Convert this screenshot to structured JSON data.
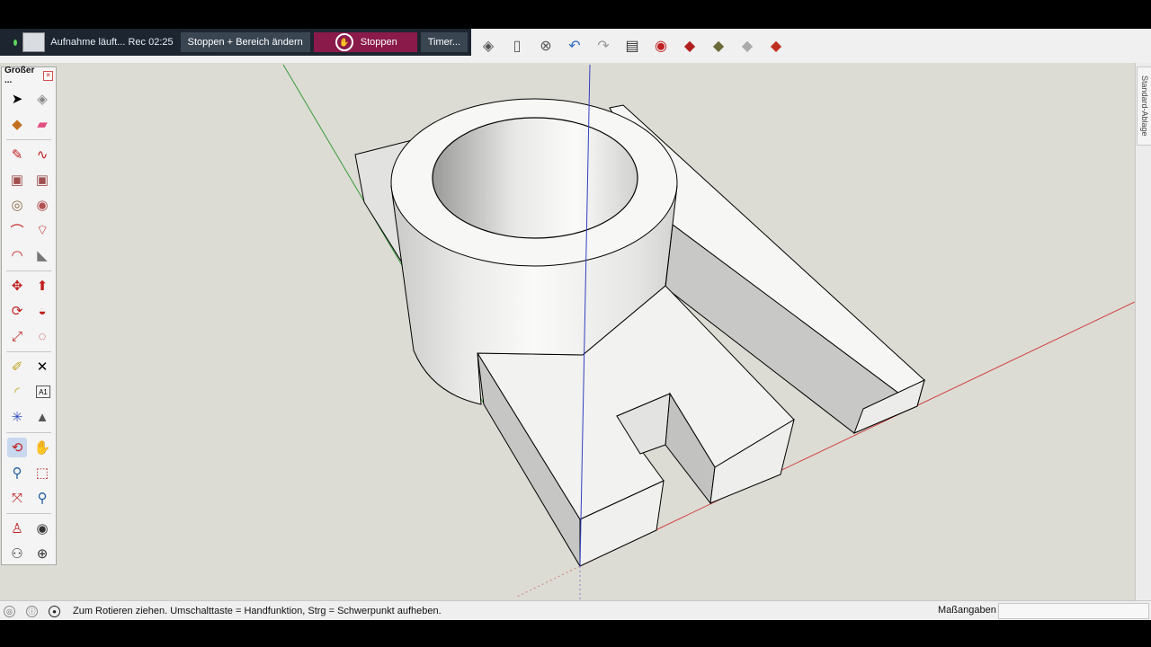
{
  "recorder": {
    "status": "Aufnahme läuft... Rec 02:25",
    "stop_change_label": "Stoppen + Bereich ändern",
    "stop_label": "Stoppen",
    "timer_label": "Timer..."
  },
  "toolbar_icons": [
    "previous-view-icon",
    "next-view-icon",
    "cancel-icon",
    "undo-icon",
    "redo-icon",
    "print-icon",
    "model-info-icon",
    "component-icon-1",
    "component-icon-2",
    "component-icon-3",
    "component-icon-4"
  ],
  "palette": {
    "title": "Großer ...",
    "close": "×",
    "text_tool_label": "A1"
  },
  "tray": {
    "tab_label": "Standard-Ablage"
  },
  "statusbar": {
    "hint": "Zum Rotieren ziehen. Umschalttaste = Handfunktion, Strg = Schwerpunkt aufheben.",
    "measure_label": "Maßangaben",
    "measure_value": ""
  },
  "colors": {
    "viewport_bg": "#dcdcd4",
    "axis_red": "#d04040",
    "axis_green": "#3a9a3a",
    "axis_blue": "#3040c0",
    "face_light": "#f4f4f2",
    "face_dark": "#c4c4c2"
  }
}
